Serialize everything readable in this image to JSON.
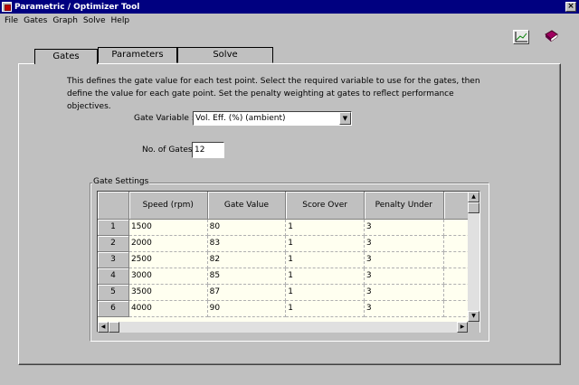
{
  "window": {
    "title": "Parametric / Optimizer Tool",
    "close_glyph": "×"
  },
  "menu": [
    "File",
    "Gates",
    "Graph",
    "Solve",
    "Help"
  ],
  "toolbar": {
    "graph_icon": "graph-icon",
    "help_icon": "book-icon"
  },
  "tabs": [
    "Gates",
    "Parameters",
    "Solve"
  ],
  "description": "This defines the gate value for each test point. Select the required variable to use for the gates, then define the value for each gate point. Set the penalty weighting at gates to reflect performance objectives.",
  "gate_variable": {
    "label": "Gate Variable :",
    "value": "Vol. Eff. (%) (ambient)"
  },
  "no_of_gates": {
    "label": "No. of Gates",
    "value": "12"
  },
  "gate_settings": {
    "title": "Gate Settings",
    "columns": [
      "Speed (rpm)",
      "Gate Value",
      "Score Over",
      "Penalty Under"
    ],
    "rows": [
      {
        "n": "1",
        "speed": "1500",
        "gate": "80",
        "score": "1",
        "penalty": "3"
      },
      {
        "n": "2",
        "speed": "2000",
        "gate": "83",
        "score": "1",
        "penalty": "3"
      },
      {
        "n": "3",
        "speed": "2500",
        "gate": "82",
        "score": "1",
        "penalty": "3"
      },
      {
        "n": "4",
        "speed": "3000",
        "gate": "85",
        "score": "1",
        "penalty": "3"
      },
      {
        "n": "5",
        "speed": "3500",
        "gate": "87",
        "score": "1",
        "penalty": "3"
      },
      {
        "n": "6",
        "speed": "4000",
        "gate": "90",
        "score": "1",
        "penalty": "3"
      }
    ]
  },
  "colors": {
    "titlebar": "#000080",
    "face": "#c0c0c0",
    "grid_bg": "#fffff0"
  }
}
